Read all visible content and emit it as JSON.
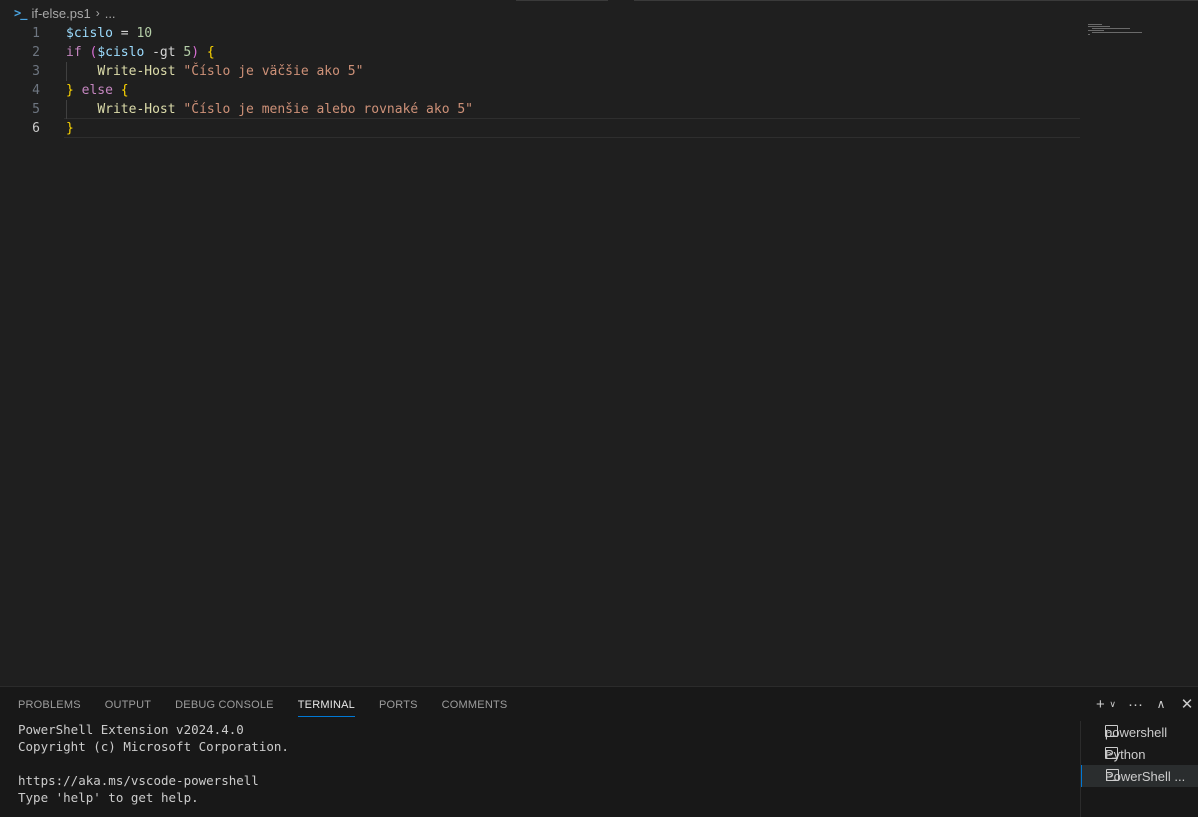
{
  "editor": {
    "breadcrumb": {
      "file": "if-else.ps1",
      "more": "..."
    },
    "code": [
      {
        "n": "1",
        "tokens": [
          [
            "var",
            "$cislo"
          ],
          [
            "op",
            " = "
          ],
          [
            "num",
            "10"
          ]
        ]
      },
      {
        "n": "2",
        "tokens": [
          [
            "kw",
            "if "
          ],
          [
            "br2",
            "("
          ],
          [
            "var",
            "$cislo"
          ],
          [
            "op",
            " -gt "
          ],
          [
            "num",
            "5"
          ],
          [
            "br2",
            ")"
          ],
          [
            "op",
            " "
          ],
          [
            "br",
            "{"
          ]
        ]
      },
      {
        "n": "3",
        "tokens": [
          [
            "plain",
            "    "
          ],
          [
            "fn",
            "Write-Host"
          ],
          [
            "op",
            " "
          ],
          [
            "str",
            "\"Číslo je väčšie ako 5\""
          ]
        ]
      },
      {
        "n": "4",
        "tokens": [
          [
            "br",
            "}"
          ],
          [
            "op",
            " "
          ],
          [
            "kw",
            "else"
          ],
          [
            "op",
            " "
          ],
          [
            "br",
            "{"
          ]
        ]
      },
      {
        "n": "5",
        "tokens": [
          [
            "plain",
            "    "
          ],
          [
            "fn",
            "Write-Host"
          ],
          [
            "op",
            " "
          ],
          [
            "str",
            "\"Číslo je menšie alebo rovnaké ako 5\""
          ]
        ]
      },
      {
        "n": "6",
        "tokens": [
          [
            "br",
            "}"
          ]
        ]
      }
    ]
  },
  "panel": {
    "tabs": [
      "PROBLEMS",
      "OUTPUT",
      "DEBUG CONSOLE",
      "TERMINAL",
      "PORTS",
      "COMMENTS"
    ],
    "active_tab": "TERMINAL",
    "terminal_lines": [
      "PowerShell Extension v2024.4.0",
      "Copyright (c) Microsoft Corporation.",
      "",
      "https://aka.ms/vscode-powershell",
      "Type 'help' to get help."
    ],
    "terminals": [
      {
        "label": "powershell",
        "active": false
      },
      {
        "label": "Python",
        "active": false
      },
      {
        "label": "PowerShell ...",
        "active": true
      }
    ]
  }
}
